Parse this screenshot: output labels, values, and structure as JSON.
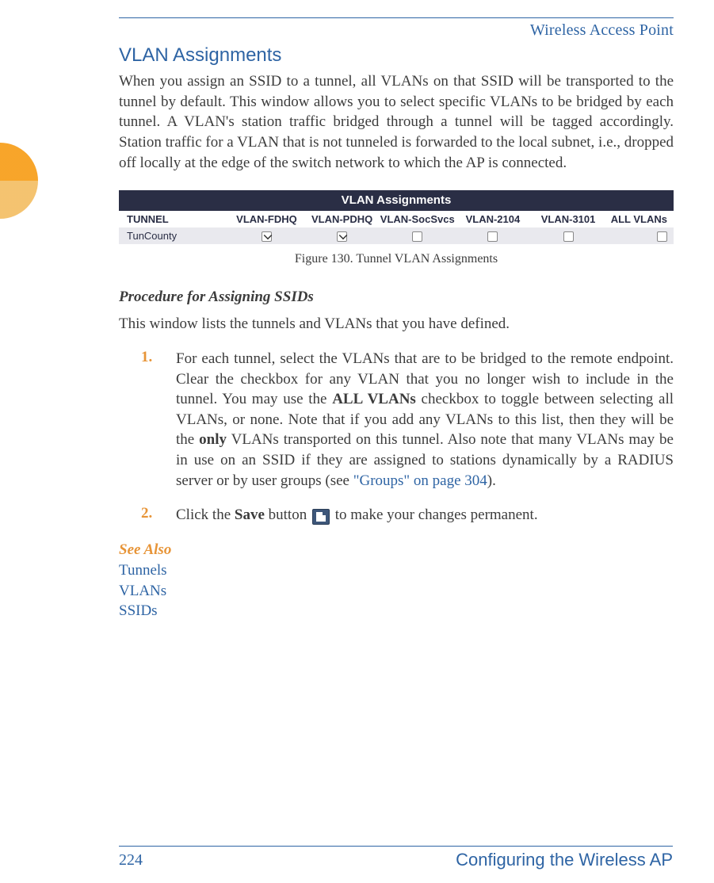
{
  "header": {
    "running_title": "Wireless Access Point"
  },
  "section": {
    "title": "VLAN Assignments",
    "intro": "When you assign an SSID to a tunnel, all VLANs on that SSID will be transported to the tunnel by default. This window allows you to select specific VLANs to be bridged by each tunnel. A VLAN's station traffic bridged through a tunnel will be tagged accordingly. Station traffic for a VLAN that is not tunneled is forwarded to the local subnet, i.e., dropped off locally at the edge of the switch network to which the AP is connected."
  },
  "figure": {
    "panel_title": "VLAN Assignments",
    "caption": "Figure 130. Tunnel VLAN Assignments",
    "columns": [
      "TUNNEL",
      "VLAN-FDHQ",
      "VLAN-PDHQ",
      "VLAN-SocSvcs",
      "VLAN-2104",
      "VLAN-3101",
      "ALL VLANs"
    ],
    "rows": [
      {
        "tunnel": "TunCounty",
        "checks": [
          true,
          true,
          false,
          false,
          false,
          false
        ]
      }
    ]
  },
  "procedure": {
    "heading": "Procedure for Assigning SSIDs",
    "lead": "This window lists the tunnels and VLANs that you have defined.",
    "steps": [
      {
        "num": "1.",
        "text_pre": "For each tunnel, select the VLANs that are to be bridged to the remote endpoint. Clear the checkbox for any VLAN that you no longer wish to include in the tunnel. You may use the ",
        "bold1": "ALL VLANs",
        "text_mid1": " checkbox to toggle between selecting all VLANs, or none. Note that if you add any VLANs to this list, then they will be the ",
        "bold2": "only",
        "text_mid2": " VLANs transported on this tunnel. Also note that many VLANs may be in use on an SSID if they are assigned to stations dynamically by a RADIUS server or by user groups (see ",
        "xref": "\"Groups\" on page 304",
        "text_post": ")."
      },
      {
        "num": "2.",
        "text_pre": "Click the ",
        "bold1": "Save",
        "text_mid1": " button ",
        "text_post": " to make your changes permanent."
      }
    ]
  },
  "see_also": {
    "heading": "See Also",
    "links": [
      "Tunnels",
      "VLANs",
      "SSIDs"
    ]
  },
  "footer": {
    "page_number": "224",
    "title": "Configuring the Wireless AP"
  }
}
